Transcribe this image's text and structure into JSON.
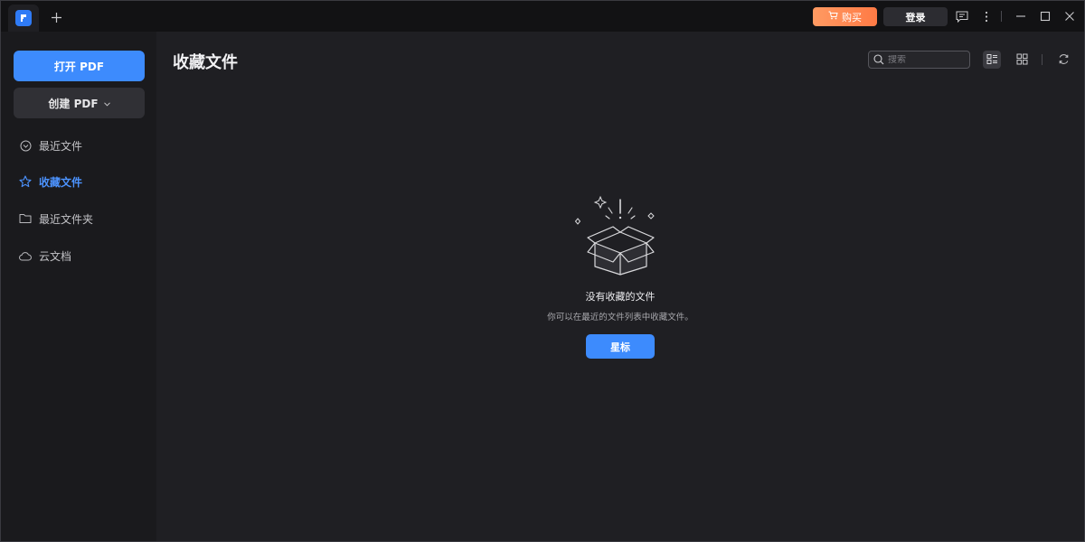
{
  "titlebar": {
    "buy_label": "购买",
    "login_label": "登录",
    "icons": [
      "app-logo-icon",
      "plus-icon",
      "cart-icon",
      "feedback-icon",
      "more-vertical-icon",
      "minimize-icon",
      "maximize-icon",
      "close-icon"
    ]
  },
  "sidebar": {
    "open_pdf_label": "打开 PDF",
    "create_pdf_label": "创建 PDF",
    "items": [
      {
        "label": "最近文件",
        "icon": "clock-icon",
        "active": false
      },
      {
        "label": "收藏文件",
        "icon": "star-icon",
        "active": true
      },
      {
        "label": "最近文件夹",
        "icon": "folder-icon",
        "active": false
      },
      {
        "label": "云文档",
        "icon": "cloud-icon",
        "active": false
      }
    ]
  },
  "main": {
    "title": "收藏文件",
    "search": {
      "placeholder": "搜索",
      "value": ""
    },
    "empty_state": {
      "title": "没有收藏的文件",
      "subtitle": "你可以在最近的文件列表中收藏文件。",
      "button_label": "星标"
    }
  },
  "colors": {
    "accent": "#3d8bfd",
    "buy_gradient_start": "#ff9a62",
    "buy_gradient_end": "#ff7a45",
    "background": "#1f1f23",
    "sidebar": "#1a1a1d",
    "titlebar": "#121214"
  }
}
